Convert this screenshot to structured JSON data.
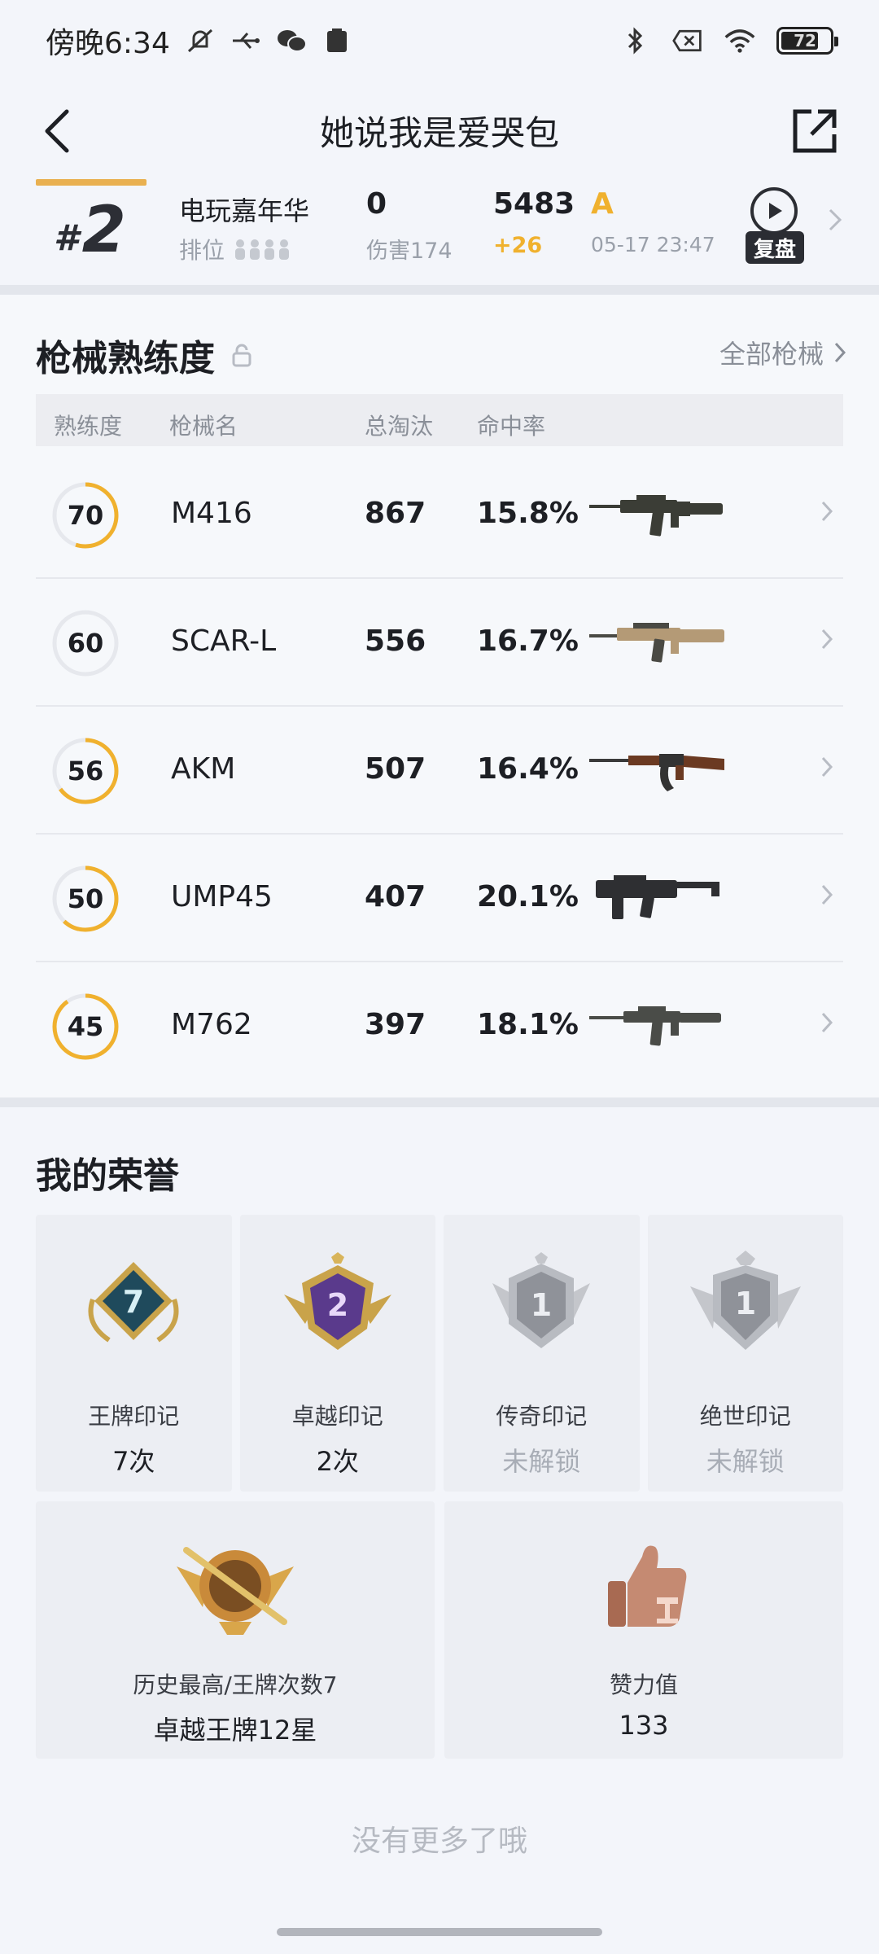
{
  "status_bar": {
    "time": "傍晚6:34",
    "battery": "72"
  },
  "header": {
    "title": "她说我是爱哭包"
  },
  "match": {
    "rank_hash": "#",
    "rank": "2",
    "mode": "电玩嘉年华",
    "mode_sub": "排位",
    "kills": "0",
    "damage": "伤害174",
    "score": "5483",
    "score_change": "+26",
    "grade": "A",
    "datetime": "05-17 23:47",
    "replay_label": "复盘"
  },
  "weapons": {
    "title": "枪械熟练度",
    "all_link": "全部枪械",
    "columns": [
      "熟练度",
      "枪械名",
      "总淘汰",
      "命中率"
    ],
    "rows": [
      {
        "level": "70",
        "name": "M416",
        "kills": "867",
        "accuracy": "15.8%",
        "progress": 0.55,
        "color": "#f0b12e"
      },
      {
        "level": "60",
        "name": "SCAR-L",
        "kills": "556",
        "accuracy": "16.7%",
        "progress": 0.0,
        "color": "#e6e8ed"
      },
      {
        "level": "56",
        "name": "AKM",
        "kills": "507",
        "accuracy": "16.4%",
        "progress": 0.65,
        "color": "#f0b12e"
      },
      {
        "level": "50",
        "name": "UMP45",
        "kills": "407",
        "accuracy": "20.1%",
        "progress": 0.62,
        "color": "#f0b12e"
      },
      {
        "level": "45",
        "name": "M762",
        "kills": "397",
        "accuracy": "18.1%",
        "progress": 0.9,
        "color": "#f0b12e"
      }
    ]
  },
  "honor": {
    "title": "我的荣誉",
    "badges": [
      {
        "label": "王牌印记",
        "value": "7次",
        "num": "7",
        "locked": false
      },
      {
        "label": "卓越印记",
        "value": "2次",
        "num": "2",
        "locked": false
      },
      {
        "label": "传奇印记",
        "value": "未解锁",
        "num": "1",
        "locked": true
      },
      {
        "label": "绝世印记",
        "value": "未解锁",
        "num": "1",
        "locked": true
      }
    ],
    "best": {
      "label": "历史最高/王牌次数7",
      "value": "卓越王牌12星"
    },
    "likes": {
      "label": "赞力值",
      "value": "133"
    }
  },
  "footer": {
    "no_more": "没有更多了哦"
  }
}
